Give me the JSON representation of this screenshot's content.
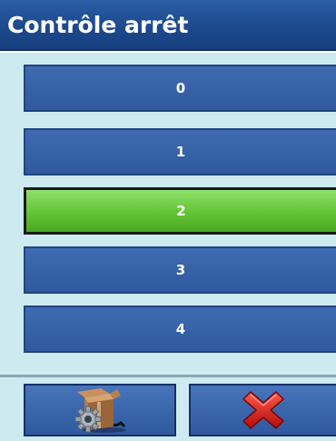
{
  "window": {
    "title": "Contrôle arrêt"
  },
  "options": [
    {
      "label": "0",
      "selected": false
    },
    {
      "label": "1",
      "selected": false
    },
    {
      "label": "2",
      "selected": true
    },
    {
      "label": "3",
      "selected": false
    },
    {
      "label": "4",
      "selected": false
    }
  ],
  "footer": {
    "settings_icon": "box-with-gear-icon",
    "cancel_icon": "red-x-icon"
  },
  "colors": {
    "title_bar": "#1f4e94",
    "option_blue": "#3a64aa",
    "selected_green": "#69c93e",
    "panel_bg": "#cdeaf0"
  }
}
